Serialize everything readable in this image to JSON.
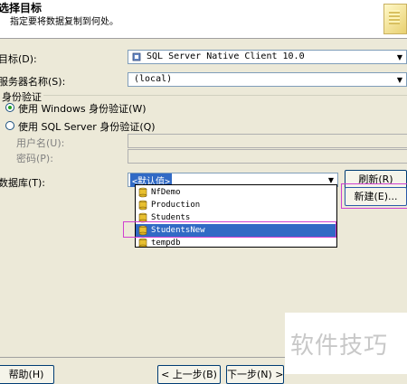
{
  "header": {
    "title": "选择目标",
    "subtitle": "指定要将数据复制到何处。"
  },
  "form": {
    "target_label": "目标(D):",
    "target_value": "SQL Server Native Client 10.0",
    "server_label": "服务器名称(S):",
    "server_value": "(local)",
    "auth_group_label": "身份验证",
    "windows_auth_label": "使用 Windows 身份验证(W)",
    "sql_auth_label": "使用 SQL Server 身份验证(Q)",
    "username_label": "用户名(U):",
    "password_label": "密码(P):",
    "database_label": "数据库(T):",
    "database_value": "<默认值>",
    "refresh_button": "刷新(R)",
    "new_button": "新建(E)..."
  },
  "dropdown": {
    "items": [
      {
        "label": "NfDemo"
      },
      {
        "label": "Production"
      },
      {
        "label": "Students"
      },
      {
        "label": "StudentsNew"
      },
      {
        "label": "tempdb"
      }
    ],
    "selected_index": 3
  },
  "footer": {
    "help_button": "帮助(H)",
    "back_button": "< 上一步(B)",
    "next_button": "下一步(N) >"
  },
  "watermark": {
    "text": "软件技巧"
  },
  "colors": {
    "selection": "#316ac5",
    "highlight_box": "#d040d0",
    "dialog_bg": "#ece9d8"
  }
}
